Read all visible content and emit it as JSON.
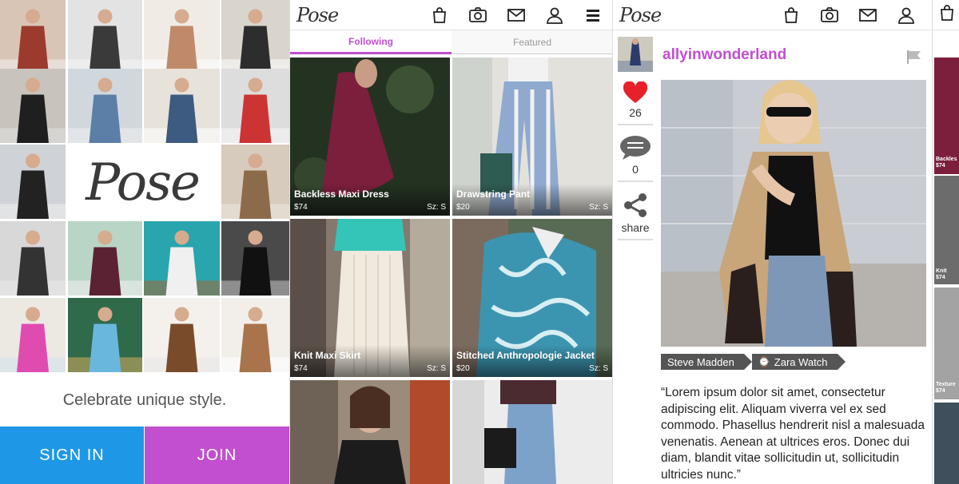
{
  "splash": {
    "logo": "Pose",
    "tagline": "Celebrate unique style.",
    "sign_in_label": "SIGN IN",
    "join_label": "JOIN"
  },
  "header": {
    "logo": "Pose"
  },
  "feed": {
    "tabs": [
      {
        "label": "Following",
        "active": true
      },
      {
        "label": "Featured",
        "active": false
      }
    ],
    "items": [
      {
        "title": "Backless Maxi Dress",
        "price": "$74",
        "size": "Sz: S"
      },
      {
        "title": "Drawstring Pant",
        "price": "$20",
        "size": "Sz: S"
      },
      {
        "title": "Knit Maxi Skirt",
        "price": "$74",
        "size": "Sz: S"
      },
      {
        "title": "Stitched Anthropologie Jacket",
        "price": "$20",
        "size": "Sz: S"
      },
      {
        "title": "",
        "price": "",
        "size": ""
      },
      {
        "title": "",
        "price": "",
        "size": ""
      }
    ]
  },
  "detail": {
    "username": "allyinwonderland",
    "likes": "26",
    "comments": "0",
    "share_label": "share",
    "tags": [
      "Steve Madden",
      "Zara Watch"
    ],
    "description": "“Lorem ipsum dolor sit amet, consectetur adipiscing elit. Aliquam viverra vel ex sed commodo. Phasellus hendrerit nisl a malesuada venenatis. Aenean at ultrices eros. Donec dui diam, blandit vitae sollicitudin ut, sollicitudin ultricies nunc.”"
  },
  "partial": {
    "captions": [
      "Backles",
      "$74",
      "Knit",
      "$74",
      "Texture",
      "$74"
    ]
  },
  "colors": {
    "accent_purple": "#c14fcf",
    "sign_in_blue": "#1e98e6",
    "heart_red": "#e8202a"
  }
}
